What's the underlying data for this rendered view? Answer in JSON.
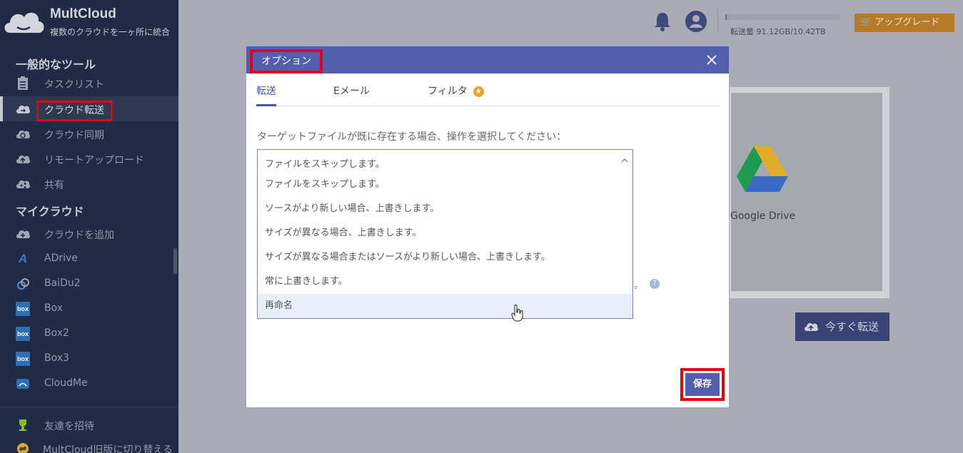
{
  "app": {
    "name": "MultCloud",
    "tagline": "複数のクラウドを一ヶ所に統合"
  },
  "sidebar": {
    "general_header": "一般的なツール",
    "general_items": [
      {
        "label": "タスクリスト",
        "icon": "task-list-icon"
      },
      {
        "label": "クラウド転送",
        "icon": "cloud-transfer-icon",
        "active": true
      },
      {
        "label": "クラウド同期",
        "icon": "cloud-sync-icon"
      },
      {
        "label": "リモートアップロード",
        "icon": "remote-upload-icon"
      },
      {
        "label": "共有",
        "icon": "share-icon"
      }
    ],
    "mycloud_header": "マイクラウド",
    "mycloud_items": [
      {
        "label": "クラウドを追加",
        "icon": "add-cloud-icon"
      },
      {
        "label": "ADrive",
        "icon": "adrive-icon"
      },
      {
        "label": "BaiDu2",
        "icon": "baidu-icon"
      },
      {
        "label": "Box",
        "icon": "box-icon"
      },
      {
        "label": "Box2",
        "icon": "box-icon"
      },
      {
        "label": "Box3",
        "icon": "box-icon"
      },
      {
        "label": "CloudMe",
        "icon": "cloudme-icon"
      }
    ],
    "bottom_items": [
      {
        "label": "友達を招待",
        "icon": "trophy-icon"
      },
      {
        "label": "MultCloud旧版に切り替える",
        "icon": "switch-icon"
      }
    ]
  },
  "header": {
    "transfer_usage": "転送量 91.12GB/10.42TB",
    "transfer_fraction": 0.009,
    "upgrade_label": "アップグレード",
    "accent": "#b57a2a"
  },
  "background": {
    "drive_label": "Google Drive",
    "transfer_now_label": "今すぐ転送"
  },
  "modal": {
    "title": "オプション",
    "tabs": [
      {
        "label": "転送",
        "active": true
      },
      {
        "label": "Eメール"
      },
      {
        "label": "フィルタ",
        "badge_icon": "star-icon"
      }
    ],
    "prompt": "ターゲットファイルが既に存在する場合、操作を選択してください：",
    "select_value": "ファイルをスキップします。",
    "options": [
      "ファイルをスキップします。",
      "ソースがより新しい場合、上書きします。",
      "サイズが異なる場合、上書きします。",
      "サイズが異なる場合またはソースがより新しい場合、上書きします。",
      "常に上書きします。",
      "再命名"
    ],
    "partial_text": "。",
    "help_glyph": "?",
    "save_label": "保存",
    "accent": "#525fae"
  }
}
